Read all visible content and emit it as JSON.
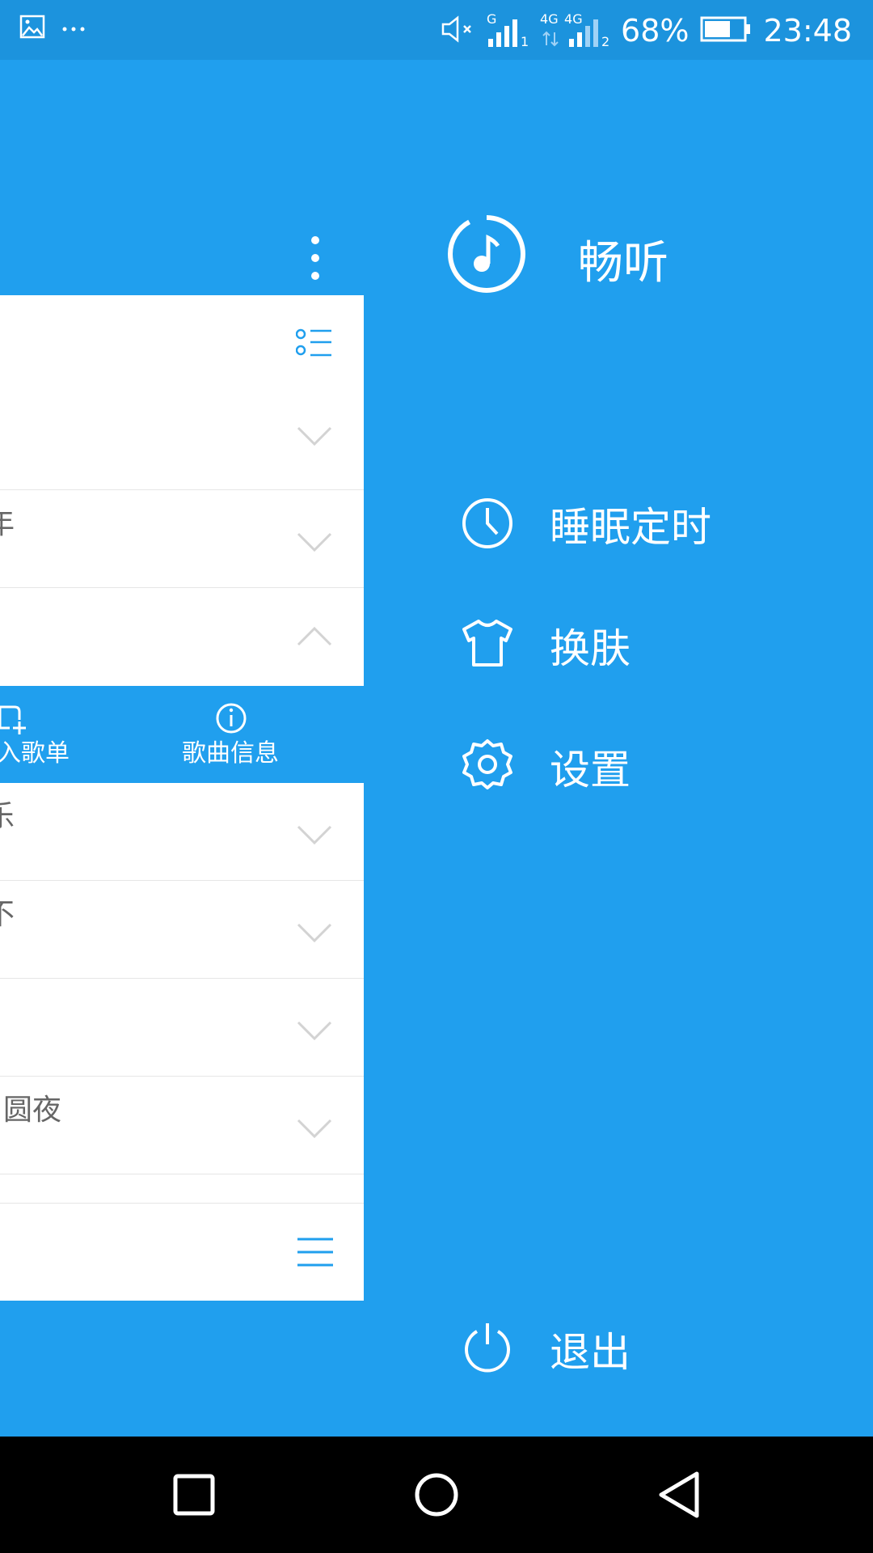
{
  "status_bar": {
    "icons_left": [
      "image-icon",
      "more-icon"
    ],
    "mute_icon": "mute-icon",
    "sim1_label": "G",
    "sim1_index": "1",
    "network_label_a": "4G",
    "network_label_b": "4G",
    "sim2_index": "2",
    "battery_percent": "68%",
    "battery_level": 0.68,
    "time": "23:48"
  },
  "main": {
    "partial_texts": {
      "row2": "年",
      "add_to_playlist": "入歌单",
      "song_info": "歌曲信息",
      "row5": "乐",
      "row6": "不",
      "row8": "圆夜"
    }
  },
  "drawer": {
    "app_name": "畅听",
    "menu": [
      {
        "icon": "clock-icon",
        "label": "睡眠定时"
      },
      {
        "icon": "tshirt-icon",
        "label": "换肤"
      },
      {
        "icon": "gear-icon",
        "label": "设置"
      }
    ],
    "exit_label": "退出"
  },
  "nav_bar": {
    "icons": [
      "recent-apps-icon",
      "home-icon",
      "back-icon"
    ]
  },
  "colors": {
    "primary": "#209FEE",
    "status_bar": "#1C93DD",
    "nav_bar": "#000000"
  }
}
